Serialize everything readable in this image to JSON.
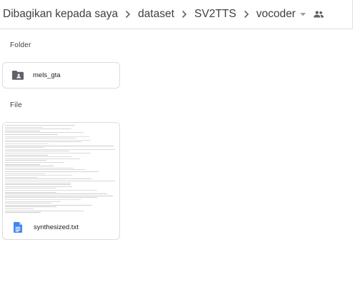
{
  "breadcrumb": {
    "items": [
      "Dibagikan kepada saya",
      "dataset",
      "SV2TTS",
      "vocoder"
    ],
    "separator_icon": "chevron-right-icon",
    "dropdown_icon": "caret-down-icon",
    "shared_icon": "people-icon"
  },
  "sections": {
    "folder_label": "Folder",
    "file_label": "File"
  },
  "folders": [
    {
      "name": "mels_gta",
      "icon": "shared-folder-icon"
    }
  ],
  "files": [
    {
      "name": "synthesized.txt",
      "icon": "google-docs-icon"
    }
  ],
  "colors": {
    "docs_blue": "#4285f4",
    "folder_gray": "#5f6368",
    "border": "#dadce0"
  }
}
